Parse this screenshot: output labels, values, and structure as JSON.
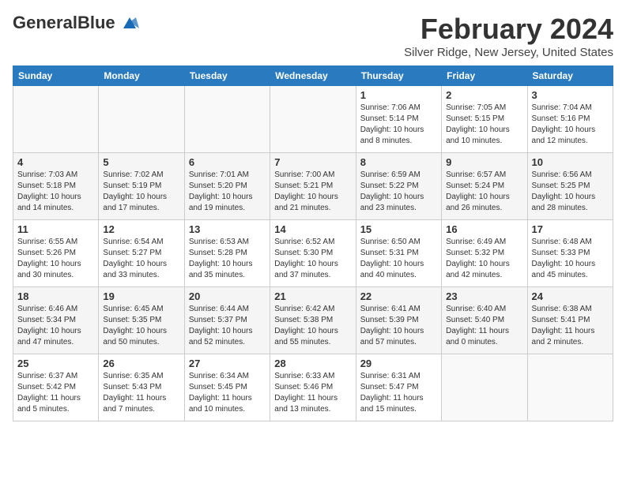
{
  "header": {
    "logo_line1": "General",
    "logo_line2": "Blue",
    "month": "February 2024",
    "location": "Silver Ridge, New Jersey, United States"
  },
  "weekdays": [
    "Sunday",
    "Monday",
    "Tuesday",
    "Wednesday",
    "Thursday",
    "Friday",
    "Saturday"
  ],
  "weeks": [
    [
      {
        "day": "",
        "info": ""
      },
      {
        "day": "",
        "info": ""
      },
      {
        "day": "",
        "info": ""
      },
      {
        "day": "",
        "info": ""
      },
      {
        "day": "1",
        "info": "Sunrise: 7:06 AM\nSunset: 5:14 PM\nDaylight: 10 hours\nand 8 minutes."
      },
      {
        "day": "2",
        "info": "Sunrise: 7:05 AM\nSunset: 5:15 PM\nDaylight: 10 hours\nand 10 minutes."
      },
      {
        "day": "3",
        "info": "Sunrise: 7:04 AM\nSunset: 5:16 PM\nDaylight: 10 hours\nand 12 minutes."
      }
    ],
    [
      {
        "day": "4",
        "info": "Sunrise: 7:03 AM\nSunset: 5:18 PM\nDaylight: 10 hours\nand 14 minutes."
      },
      {
        "day": "5",
        "info": "Sunrise: 7:02 AM\nSunset: 5:19 PM\nDaylight: 10 hours\nand 17 minutes."
      },
      {
        "day": "6",
        "info": "Sunrise: 7:01 AM\nSunset: 5:20 PM\nDaylight: 10 hours\nand 19 minutes."
      },
      {
        "day": "7",
        "info": "Sunrise: 7:00 AM\nSunset: 5:21 PM\nDaylight: 10 hours\nand 21 minutes."
      },
      {
        "day": "8",
        "info": "Sunrise: 6:59 AM\nSunset: 5:22 PM\nDaylight: 10 hours\nand 23 minutes."
      },
      {
        "day": "9",
        "info": "Sunrise: 6:57 AM\nSunset: 5:24 PM\nDaylight: 10 hours\nand 26 minutes."
      },
      {
        "day": "10",
        "info": "Sunrise: 6:56 AM\nSunset: 5:25 PM\nDaylight: 10 hours\nand 28 minutes."
      }
    ],
    [
      {
        "day": "11",
        "info": "Sunrise: 6:55 AM\nSunset: 5:26 PM\nDaylight: 10 hours\nand 30 minutes."
      },
      {
        "day": "12",
        "info": "Sunrise: 6:54 AM\nSunset: 5:27 PM\nDaylight: 10 hours\nand 33 minutes."
      },
      {
        "day": "13",
        "info": "Sunrise: 6:53 AM\nSunset: 5:28 PM\nDaylight: 10 hours\nand 35 minutes."
      },
      {
        "day": "14",
        "info": "Sunrise: 6:52 AM\nSunset: 5:30 PM\nDaylight: 10 hours\nand 37 minutes."
      },
      {
        "day": "15",
        "info": "Sunrise: 6:50 AM\nSunset: 5:31 PM\nDaylight: 10 hours\nand 40 minutes."
      },
      {
        "day": "16",
        "info": "Sunrise: 6:49 AM\nSunset: 5:32 PM\nDaylight: 10 hours\nand 42 minutes."
      },
      {
        "day": "17",
        "info": "Sunrise: 6:48 AM\nSunset: 5:33 PM\nDaylight: 10 hours\nand 45 minutes."
      }
    ],
    [
      {
        "day": "18",
        "info": "Sunrise: 6:46 AM\nSunset: 5:34 PM\nDaylight: 10 hours\nand 47 minutes."
      },
      {
        "day": "19",
        "info": "Sunrise: 6:45 AM\nSunset: 5:35 PM\nDaylight: 10 hours\nand 50 minutes."
      },
      {
        "day": "20",
        "info": "Sunrise: 6:44 AM\nSunset: 5:37 PM\nDaylight: 10 hours\nand 52 minutes."
      },
      {
        "day": "21",
        "info": "Sunrise: 6:42 AM\nSunset: 5:38 PM\nDaylight: 10 hours\nand 55 minutes."
      },
      {
        "day": "22",
        "info": "Sunrise: 6:41 AM\nSunset: 5:39 PM\nDaylight: 10 hours\nand 57 minutes."
      },
      {
        "day": "23",
        "info": "Sunrise: 6:40 AM\nSunset: 5:40 PM\nDaylight: 11 hours\nand 0 minutes."
      },
      {
        "day": "24",
        "info": "Sunrise: 6:38 AM\nSunset: 5:41 PM\nDaylight: 11 hours\nand 2 minutes."
      }
    ],
    [
      {
        "day": "25",
        "info": "Sunrise: 6:37 AM\nSunset: 5:42 PM\nDaylight: 11 hours\nand 5 minutes."
      },
      {
        "day": "26",
        "info": "Sunrise: 6:35 AM\nSunset: 5:43 PM\nDaylight: 11 hours\nand 7 minutes."
      },
      {
        "day": "27",
        "info": "Sunrise: 6:34 AM\nSunset: 5:45 PM\nDaylight: 11 hours\nand 10 minutes."
      },
      {
        "day": "28",
        "info": "Sunrise: 6:33 AM\nSunset: 5:46 PM\nDaylight: 11 hours\nand 13 minutes."
      },
      {
        "day": "29",
        "info": "Sunrise: 6:31 AM\nSunset: 5:47 PM\nDaylight: 11 hours\nand 15 minutes."
      },
      {
        "day": "",
        "info": ""
      },
      {
        "day": "",
        "info": ""
      }
    ]
  ]
}
